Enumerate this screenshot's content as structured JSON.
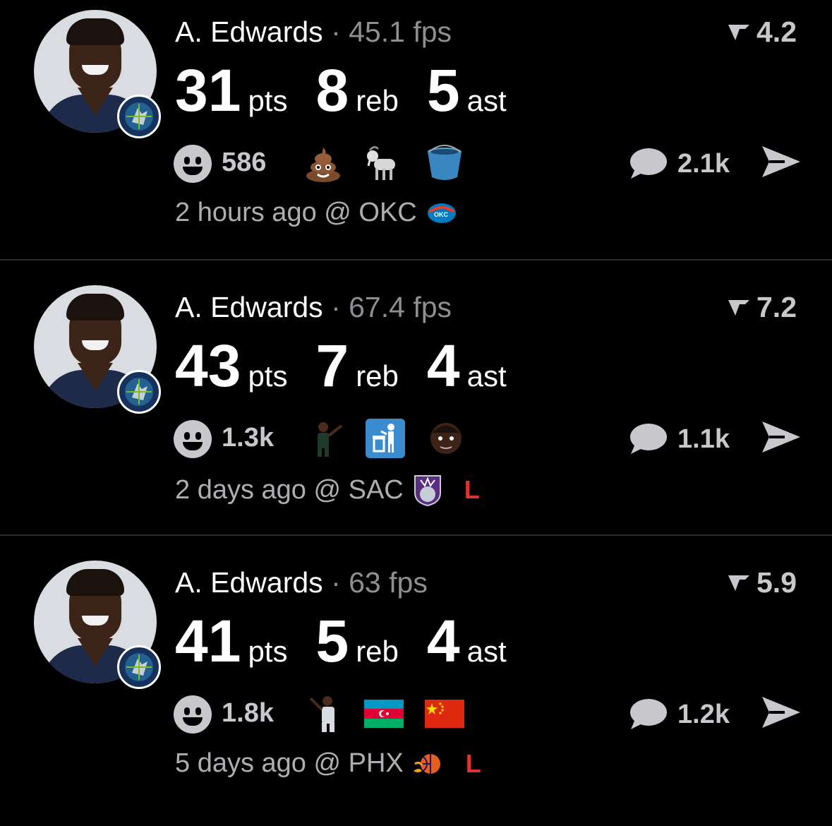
{
  "posts": [
    {
      "player": "A. Edwards",
      "separator": "·",
      "fps": "45.1 fps",
      "score": "4.2",
      "stats": [
        {
          "value": "31",
          "label": "pts"
        },
        {
          "value": "8",
          "label": "reb"
        },
        {
          "value": "5",
          "label": "ast"
        }
      ],
      "reaction_count": "586",
      "reaction_emojis": [
        "poop-emoji",
        "goat-emoji",
        "bucket-emoji"
      ],
      "comment_count": "2.1k",
      "time": "2 hours ago @ OKC",
      "opponent_logo": "okc-thunder-logo",
      "result": ""
    },
    {
      "player": "A. Edwards",
      "separator": "·",
      "fps": "67.4 fps",
      "score": "7.2",
      "stats": [
        {
          "value": "43",
          "label": "pts"
        },
        {
          "value": "7",
          "label": "reb"
        },
        {
          "value": "4",
          "label": "ast"
        }
      ],
      "reaction_count": "1.3k",
      "reaction_emojis": [
        "player-celebrate-sticker",
        "trash-can-emoji",
        "player-face-sticker"
      ],
      "comment_count": "1.1k",
      "time": "2 days ago @ SAC",
      "opponent_logo": "sacramento-kings-logo",
      "result": "L"
    },
    {
      "player": "A. Edwards",
      "separator": "·",
      "fps": "63 fps",
      "score": "5.9",
      "stats": [
        {
          "value": "41",
          "label": "pts"
        },
        {
          "value": "5",
          "label": "reb"
        },
        {
          "value": "4",
          "label": "ast"
        }
      ],
      "reaction_count": "1.8k",
      "reaction_emojis": [
        "player-pointing-sticker",
        "azerbaijan-flag",
        "china-flag"
      ],
      "comment_count": "1.2k",
      "time": "5 days ago @ PHX",
      "opponent_logo": "phoenix-suns-logo",
      "result": "L"
    }
  ],
  "colors": {
    "background": "#000000",
    "primary_text": "#ffffff",
    "secondary_text": "#8e8e93",
    "loss": "#e0332d",
    "separator": "#2a2a2c"
  }
}
